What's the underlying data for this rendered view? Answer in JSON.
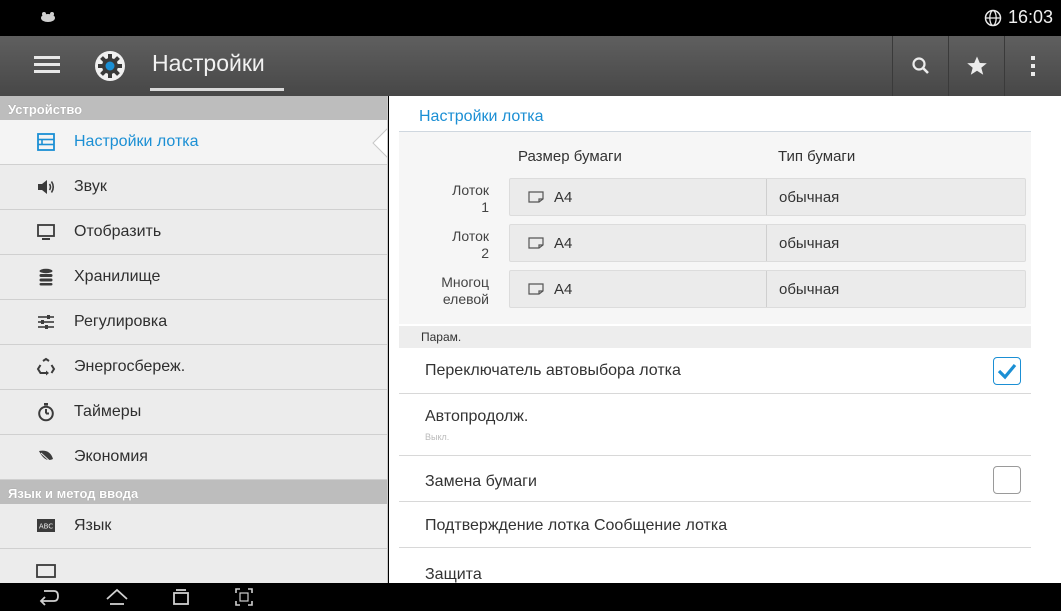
{
  "status_bar": {
    "time": "16:03"
  },
  "action_bar": {
    "title": "Настройки",
    "accent_color": "#1b8fd4",
    "icons": [
      "menu-icon",
      "gear-icon",
      "search-icon",
      "star-icon",
      "more-vert-icon"
    ]
  },
  "sidebar": {
    "section1_header": "Устройство",
    "section1_items": [
      {
        "label": "Настройки лотка",
        "icon": "tray-settings-icon",
        "active": true
      },
      {
        "label": "Звук",
        "icon": "speaker-icon"
      },
      {
        "label": "Отобразить",
        "icon": "monitor-icon"
      },
      {
        "label": "Хранилище",
        "icon": "database-icon"
      },
      {
        "label": "Регулировка",
        "icon": "sliders-icon"
      },
      {
        "label": "Энергосбереж.",
        "icon": "recycle-icon"
      },
      {
        "label": "Таймеры",
        "icon": "stopwatch-icon"
      },
      {
        "label": "Экономия",
        "icon": "leaf-icon"
      }
    ],
    "section2_header": "Язык и метод ввода",
    "section2_items": [
      {
        "label": "Язык",
        "icon": "language-abc-icon"
      }
    ]
  },
  "main": {
    "title": "Настройки лотка",
    "columns": {
      "size": "Размер бумаги",
      "type": "Тип бумаги"
    },
    "trays": [
      {
        "label_line1": "Лоток",
        "label_line2": "1",
        "size": "A4",
        "type": "обычная"
      },
      {
        "label_line1": "Лоток",
        "label_line2": "2",
        "size": "A4",
        "type": "обычная"
      },
      {
        "label_line1": "Многоц",
        "label_line2": "елевой",
        "size": "A4",
        "type": "обычная"
      }
    ],
    "params_header": "Парам.",
    "options": {
      "auto_tray_switch": {
        "label": "Переключатель автовыбора лотка",
        "checked": true
      },
      "auto_continue": {
        "label": "Автопродолж.",
        "sub": "Выкл."
      },
      "paper_substitution": {
        "label": "Замена бумаги",
        "checked": false
      },
      "tray_confirmation": {
        "label": "Подтверждение лотка Сообщение лотка"
      },
      "protection": {
        "label": "Защита"
      }
    }
  }
}
